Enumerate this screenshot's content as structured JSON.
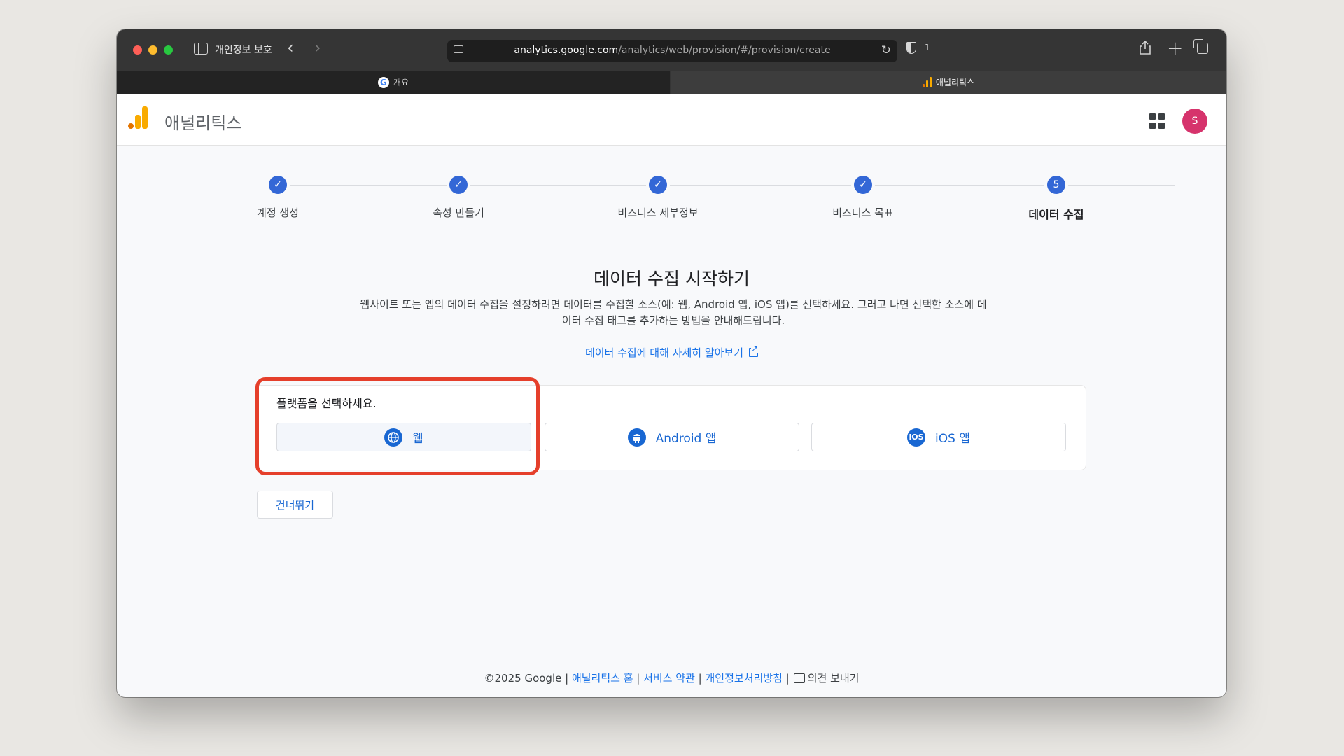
{
  "browser": {
    "private_label": "개인정보 보호",
    "url_host": "analytics.google.com",
    "url_path": "/analytics/web/provision/#/provision/create",
    "shield_count": "1",
    "tabs": [
      {
        "label": "개요",
        "icon": "google-icon"
      },
      {
        "label": "애널리틱스",
        "icon": "analytics-icon"
      }
    ]
  },
  "app": {
    "title": "애널리틱스",
    "avatar_letter": "S",
    "accent_color": "#1a73e8"
  },
  "stepper": {
    "steps": [
      {
        "label": "계정 생성",
        "state": "done",
        "marker": "✓"
      },
      {
        "label": "속성 만들기",
        "state": "done",
        "marker": "✓"
      },
      {
        "label": "비즈니스 세부정보",
        "state": "done",
        "marker": "✓"
      },
      {
        "label": "비즈니스 목표",
        "state": "done",
        "marker": "✓"
      },
      {
        "label": "데이터 수집",
        "state": "active",
        "marker": "5"
      }
    ]
  },
  "main": {
    "heading": "데이터 수집 시작하기",
    "description_line1": "웹사이트 또는 앱의 데이터 수집을 설정하려면 데이터를 수집할 소스(예: 웹, Android 앱, iOS 앱)를 선택하세요. 그러고 나면 선택한 소스에 데",
    "description_line2": "이터 수집 태그를 추가하는 방법을 안내해드립니다.",
    "learn_more": "데이터 수집에 대해 자세히 알아보기",
    "platform_prompt": "플랫폼을 선택하세요.",
    "platforms": [
      {
        "label": "웹",
        "icon": "globe-icon"
      },
      {
        "label": "Android 앱",
        "icon": "android-icon"
      },
      {
        "label": "iOS 앱",
        "icon": "ios-icon"
      }
    ],
    "skip_label": "건너뛰기"
  },
  "footer": {
    "copyright": "©2025 Google",
    "links": [
      "애널리틱스 홈",
      "서비스 약관",
      "개인정보처리방침"
    ],
    "feedback": "의견 보내기"
  }
}
